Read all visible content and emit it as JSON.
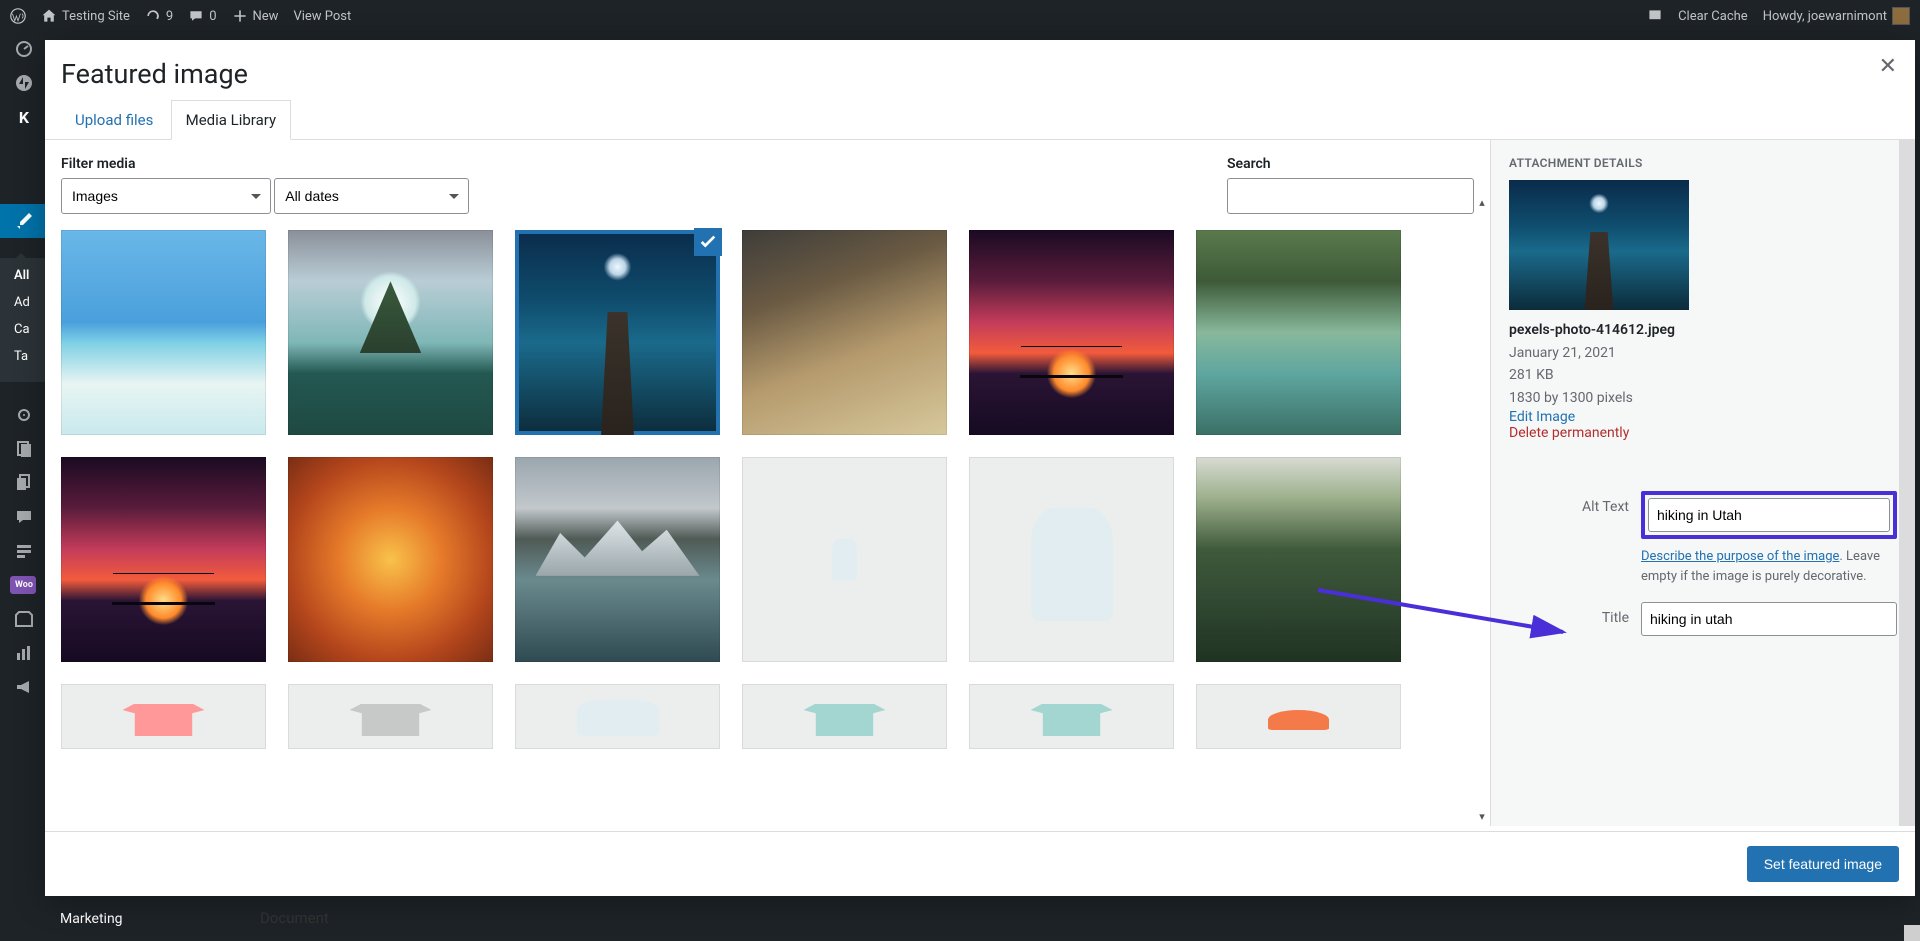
{
  "adminbar": {
    "site": "Testing Site",
    "updates": "9",
    "comments": "0",
    "new": "New",
    "viewpost": "View Post",
    "clearcache": "Clear Cache",
    "howdy": "Howdy, joewarnimont"
  },
  "wpsidebar": {
    "k_label": "K",
    "woo_label": "Woo",
    "submenu": {
      "all": "All",
      "add": "Ad",
      "cat": "Ca",
      "tag": "Ta"
    },
    "bottom": "Marketing"
  },
  "bg": {
    "doc": "Document"
  },
  "modal": {
    "title": "Featured image",
    "tab_upload": "Upload files",
    "tab_library": "Media Library",
    "filter_label": "Filter media",
    "filter_type": "Images",
    "filter_date": "All dates",
    "search_label": "Search",
    "footer_btn": "Set featured image"
  },
  "details": {
    "heading": "ATTACHMENT DETAILS",
    "filename": "pexels-photo-414612.jpeg",
    "date": "January 21, 2021",
    "size": "281 KB",
    "dims": "1830 by 1300 pixels",
    "edit": "Edit Image",
    "delete": "Delete permanently",
    "alt_label": "Alt Text",
    "alt_value": "hiking in Utah",
    "hint_link": "Describe the purpose of the image",
    "hint_rest": ". Leave empty if the image is purely decorative.",
    "title_label": "Title",
    "title_value": "hiking in utah"
  }
}
